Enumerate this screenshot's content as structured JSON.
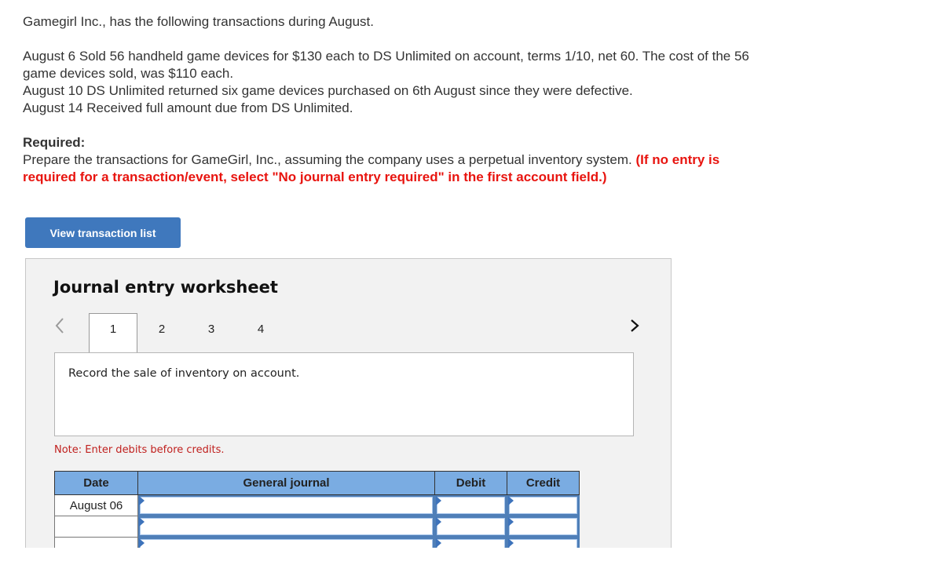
{
  "problem": {
    "intro": "Gamegirl Inc., has the following transactions during August.",
    "transactions": [
      "August 6 Sold 56 handheld game devices for $130 each to DS Unlimited on account, terms 1/10, net 60. The cost of the 56",
      "game devices sold, was $110 each.",
      "August 10 DS Unlimited returned six game devices purchased on 6th August since they were defective.",
      "August 14 Received full amount due from DS Unlimited."
    ],
    "required_heading": "Required:",
    "required_text": "Prepare the transactions for GameGirl, Inc., assuming the company uses a perpetual inventory system.",
    "required_instruction_line1": "(If no entry is",
    "required_instruction_line2": "required for a transaction/event, select \"No journal entry required\" in the first account field.)"
  },
  "view_transaction_button": "View transaction list",
  "worksheet": {
    "title": "Journal entry worksheet",
    "prev_icon": "chevron-left",
    "next_icon": "chevron-right",
    "tabs": [
      {
        "label": "1",
        "active": true
      },
      {
        "label": "2",
        "active": false
      },
      {
        "label": "3",
        "active": false
      },
      {
        "label": "4",
        "active": false
      }
    ],
    "description": "Record the sale of inventory on account.",
    "note": "Note: Enter debits before credits.",
    "table": {
      "headers": [
        "Date",
        "General journal",
        "Debit",
        "Credit"
      ],
      "rows": [
        {
          "date": "August 06",
          "account": "",
          "debit": "",
          "credit": ""
        },
        {
          "date": "",
          "account": "",
          "debit": "",
          "credit": ""
        },
        {
          "date": "",
          "account": "",
          "debit": "",
          "credit": ""
        }
      ]
    }
  },
  "colors": {
    "button_blue": "#3f78bd",
    "header_blue": "#7aace2",
    "instruction_red": "#e8140f",
    "note_red": "#c0201e"
  }
}
